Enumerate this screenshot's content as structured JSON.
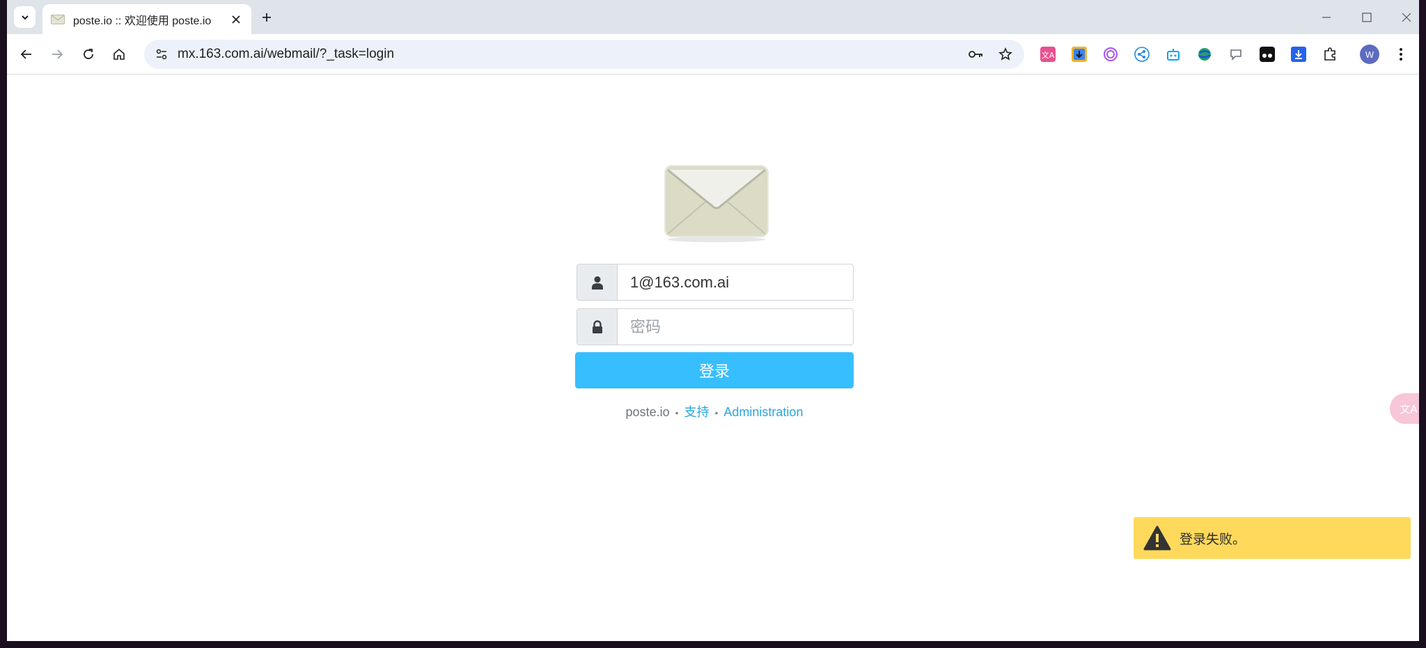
{
  "browser": {
    "tab_title": "poste.io :: 欢迎使用 poste.io",
    "url": "mx.163.com.ai/webmail/?_task=login",
    "profile_initial": "W"
  },
  "login": {
    "username_value": "1@163.com.ai",
    "password_placeholder": "密码",
    "login_button": "登录"
  },
  "footer": {
    "brand": "poste.io",
    "separator": "•",
    "support_link": "支持",
    "admin_link": "Administration"
  },
  "notification": {
    "message": "登录失败。"
  },
  "colors": {
    "login_button": "#37beff",
    "link": "#27a7e0",
    "toast_background": "#ffd95c"
  }
}
